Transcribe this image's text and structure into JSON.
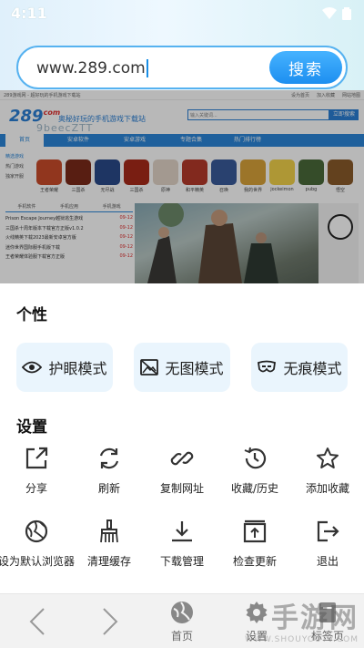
{
  "status_bar": {
    "time": "4:11"
  },
  "search": {
    "url": "www.289.com",
    "button": "搜索"
  },
  "webpage": {
    "topbar_left": "289游戏网 - 超好玩的手机游戏下载站",
    "topbar_links": [
      "设为首页",
      "加入收藏",
      "网站地图"
    ],
    "logo": "289",
    "logo_suffix": "com",
    "tagline": "奥秘好玩的手机游戏下载站",
    "overlay_text": "9beecZTT",
    "search_placeholder": "输入关键词...",
    "search_button": "立即搜索",
    "nav": [
      "首页",
      "安卓软件",
      "安卓游戏",
      "专题合集",
      "热门排行榜"
    ],
    "left_links": [
      "精选游戏",
      "热门游戏",
      "独家开服"
    ],
    "games": [
      "王者荣耀",
      "三国杀",
      "无尽战",
      "三国杀",
      "原神",
      "和平精英",
      "召唤",
      "我的世界",
      "jockeimon",
      "pubg",
      "悟空"
    ],
    "tabs": [
      "手机软件",
      "手机应用",
      "手机游戏"
    ],
    "news": [
      {
        "t": "Prison Escape Journey越狱逃生游戏",
        "d": "09-12"
      },
      {
        "t": "三国杀十周年版本下载官方正版v1.0.2",
        "d": "09-12"
      },
      {
        "t": "火线精英下载2023最新安卓官方版",
        "d": "09-12"
      },
      {
        "t": "迷你世界国际服手机版下载",
        "d": "09-12"
      },
      {
        "t": "王者荣耀体验服下载官方正版",
        "d": "09-12"
      }
    ]
  },
  "panel": {
    "personal_title": "个性",
    "modes": [
      {
        "icon": "eye-icon",
        "label": "护眼模式"
      },
      {
        "icon": "no-image-icon",
        "label": "无图模式"
      },
      {
        "icon": "incognito-mask-icon",
        "label": "无痕模式"
      }
    ],
    "settings_title": "设置",
    "row1": [
      {
        "icon": "share-icon",
        "label": "分享"
      },
      {
        "icon": "refresh-icon",
        "label": "刷新"
      },
      {
        "icon": "link-icon",
        "label": "复制网址"
      },
      {
        "icon": "history-icon",
        "label": "收藏/历史"
      },
      {
        "icon": "star-icon",
        "label": "添加收藏"
      }
    ],
    "row2": [
      {
        "icon": "globe-icon",
        "label": "设为默认浏览器"
      },
      {
        "icon": "broom-icon",
        "label": "清理缓存"
      },
      {
        "icon": "download-icon",
        "label": "下载管理"
      },
      {
        "icon": "upload-icon",
        "label": "检查更新"
      },
      {
        "icon": "exit-icon",
        "label": "退出"
      }
    ]
  },
  "bottom_nav": {
    "home": "首页",
    "settings": "设置",
    "tabs": "标签页"
  },
  "watermark": {
    "line1": "手游网",
    "line2": "WWW.SHOUYOUTV.COM"
  },
  "colors": {
    "accent": "#1d8ff0",
    "mode_bg": "#eaf5fd",
    "web_nav": "#2b86d8"
  }
}
